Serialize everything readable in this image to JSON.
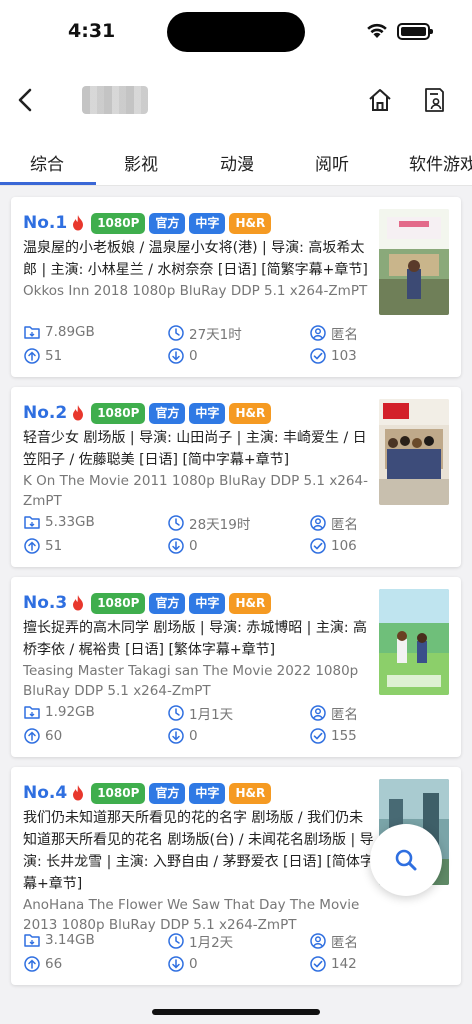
{
  "status": {
    "time": "4:31"
  },
  "tabs": [
    "综合",
    "影视",
    "动漫",
    "阅听",
    "软件游戏"
  ],
  "cards": [
    {
      "rank": "No.1",
      "tags": [
        "1080P",
        "官方",
        "中字",
        "H&R"
      ],
      "title": "温泉屋的小老板娘 / 温泉屋小女将(港) | 导演: 高坂希太郎 | 主演: 小林星兰 / 水树奈奈 [日语] [简繁字幕+章节]",
      "subtitle": "Okkos Inn 2018 1080p BluRay DDP 5.1 x264-ZmPT",
      "size": "7.89GB",
      "time": "27天1时",
      "uploader": "匿名",
      "seeders": "51",
      "leechers": "0",
      "completed": "103"
    },
    {
      "rank": "No.2",
      "tags": [
        "1080P",
        "官方",
        "中字",
        "H&R"
      ],
      "title": "轻音少女 剧场版 | 导演: 山田尚子 | 主演: 丰崎爱生 / 日笠阳子 / 佐藤聪美 [日语] [简中字幕+章节]",
      "subtitle": "K On The Movie 2011 1080p BluRay DDP 5.1 x264-ZmPT",
      "size": "5.33GB",
      "time": "28天19时",
      "uploader": "匿名",
      "seeders": "51",
      "leechers": "0",
      "completed": "106"
    },
    {
      "rank": "No.3",
      "tags": [
        "1080P",
        "官方",
        "中字",
        "H&R"
      ],
      "title": "擅长捉弄的高木同学 剧场版 | 导演: 赤城博昭 | 主演: 高桥李依 / 梶裕贵 [日语] [繁体字幕+章节]",
      "subtitle": "Teasing Master Takagi san The Movie 2022 1080p BluRay DDP 5.1 x264-ZmPT",
      "size": "1.92GB",
      "time": "1月1天",
      "uploader": "匿名",
      "seeders": "60",
      "leechers": "0",
      "completed": "155"
    },
    {
      "rank": "No.4",
      "tags": [
        "1080P",
        "官方",
        "中字",
        "H&R"
      ],
      "title": "我们仍未知道那天所看见的花的名字 剧场版 / 我们仍未知道那天所看见的花名 剧场版(台) / 未闻花名剧场版 | 导演: 长井龙雪 | 主演: 入野自由 / 茅野爱衣 [日语] [简体字幕+章节]",
      "subtitle": "AnoHana The Flower We Saw That Day The Movie 2013 1080p BluRay DDP 5.1 x264-ZmPT",
      "size": "3.14GB",
      "time": "1月2天",
      "uploader": "匿名",
      "seeders": "66",
      "leechers": "0",
      "completed": "142"
    }
  ]
}
